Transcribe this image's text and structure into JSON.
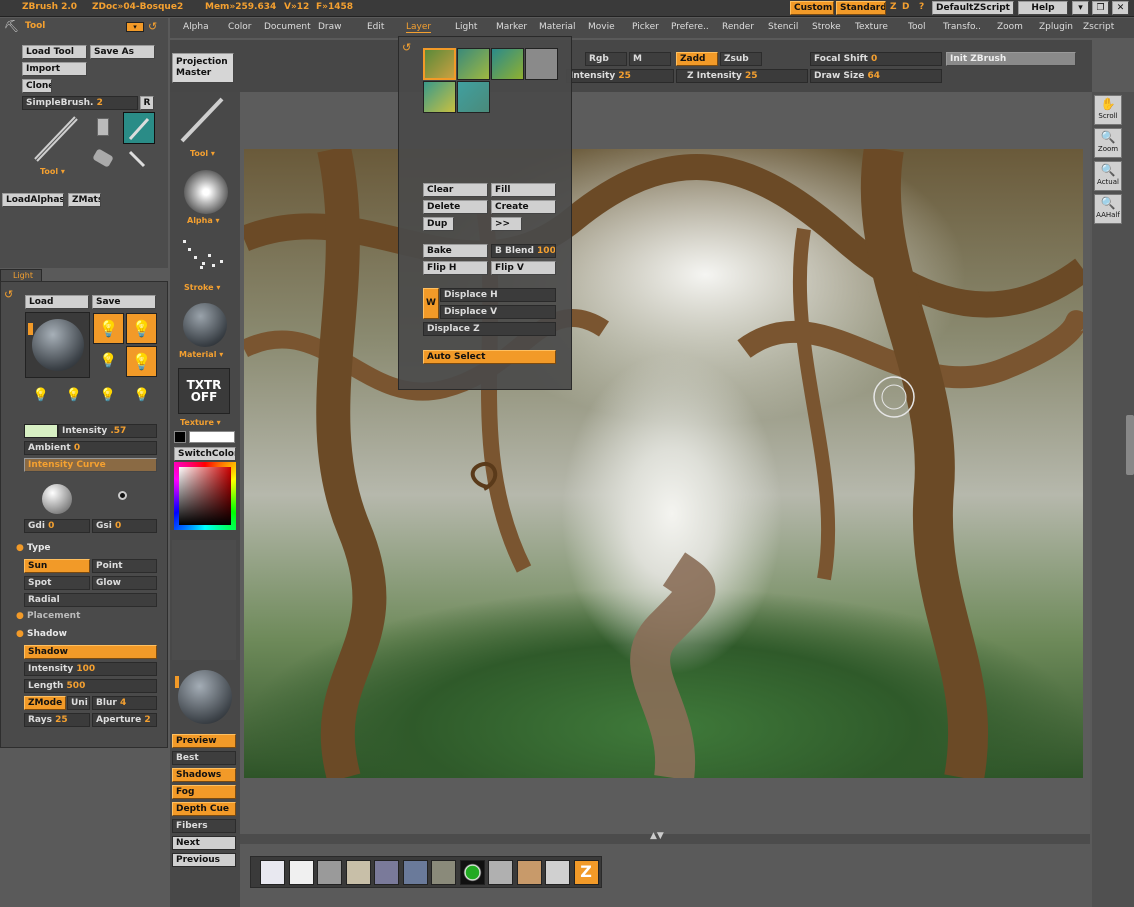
{
  "titlebar": {
    "app": "ZBrush 2.0",
    "doc": "ZDoc»04-Bosque2",
    "mem": "Mem»259.634",
    "verts": "V»12",
    "fps": "F»1458",
    "custom": "Custom",
    "standard": "Standard",
    "z": "Z",
    "d": "D",
    "q": "?",
    "script": "DefaultZScript",
    "help": "Help"
  },
  "menu": [
    "Alpha",
    "Color",
    "Document",
    "Draw",
    "Edit",
    "Layer",
    "Light",
    "Marker",
    "Material",
    "Movie",
    "Picker",
    "Prefere..",
    "Render",
    "Stencil",
    "Stroke",
    "Texture",
    "Tool",
    "Transfo..",
    "Zoom",
    "Zplugin",
    "Zscript"
  ],
  "menu_active": "Layer",
  "top_shelf": {
    "projection_master": [
      "Projection",
      "Master"
    ],
    "rgb": "Rgb",
    "m": "M",
    "zadd": "Zadd",
    "zsub": "Zsub",
    "focal_shift_label": "Focal Shift",
    "focal_shift_val": "0",
    "init_zbrush": "Init ZBrush",
    "rgb_intensity_label": "Intensity",
    "rgb_intensity_val": "25",
    "z_intensity_label": "Z Intensity",
    "z_intensity_val": "25",
    "draw_size_label": "Draw Size",
    "draw_size_val": "64"
  },
  "tool_palette": {
    "title": "Tool",
    "load_tool": "Load Tool",
    "save_as": "Save As",
    "import": "Import",
    "clone": "Clone",
    "brush_label": "SimpleBrush.",
    "brush_num": "2",
    "r": "R",
    "tool_dropdown": "Tool",
    "load_alphas": "LoadAlphas",
    "zmats": "ZMats"
  },
  "left_tray": {
    "tool": "Tool",
    "alpha": "Alpha",
    "stroke": "Stroke",
    "material": "Material",
    "txtr": [
      "TXTR",
      "OFF"
    ],
    "texture": "Texture",
    "switch_color": "SwitchColor",
    "render_buttons": [
      "Preview",
      "Best",
      "Shadows",
      "Fog",
      "Depth Cue",
      "Fibers",
      "Next",
      "Previous"
    ]
  },
  "light_palette": {
    "tab": "Light",
    "load": "Load",
    "save": "Save",
    "intensity_label": "Intensity",
    "intensity_val": ".57",
    "ambient_label": "Ambient",
    "ambient_val": "0",
    "intensity_curve": "Intensity Curve",
    "gdi_label": "Gdi",
    "gdi_val": "0",
    "gsi_label": "Gsi",
    "gsi_val": "0",
    "type_header": "Type",
    "sun": "Sun",
    "point": "Point",
    "spot": "Spot",
    "glow": "Glow",
    "radial": "Radial",
    "placement_header": "Placement",
    "shadow_header": "Shadow",
    "shadow_btn": "Shadow",
    "sh_intensity_label": "Intensity",
    "sh_intensity_val": "100",
    "length_label": "Length",
    "length_val": "500",
    "zmode": "ZMode",
    "uni": "Uni",
    "blur_label": "Blur",
    "blur_val": "4",
    "rays_label": "Rays",
    "rays_val": "25",
    "aperture_label": "Aperture",
    "aperture_val": "2"
  },
  "layer_menu": {
    "clear": "Clear",
    "fill": "Fill",
    "delete": "Delete",
    "create": "Create",
    "dup": "Dup",
    "arrows": ">>",
    "bake": "Bake",
    "b_blend_label": "B Blend",
    "b_blend_val": "100",
    "flip_h": "Flip H",
    "flip_v": "Flip V",
    "w": "W",
    "displace_h": "Displace H",
    "displace_v": "Displace V",
    "displace_z": "Displace Z",
    "auto_select": "Auto Select"
  },
  "right_tray": [
    "Scroll",
    "Zoom",
    "Actual",
    "AAHalf"
  ],
  "colors": {
    "accent": "#f29a28",
    "panel": "#4a4a4a",
    "background": "#5a5a5a",
    "canvas_bg": "#5c5c5c"
  }
}
